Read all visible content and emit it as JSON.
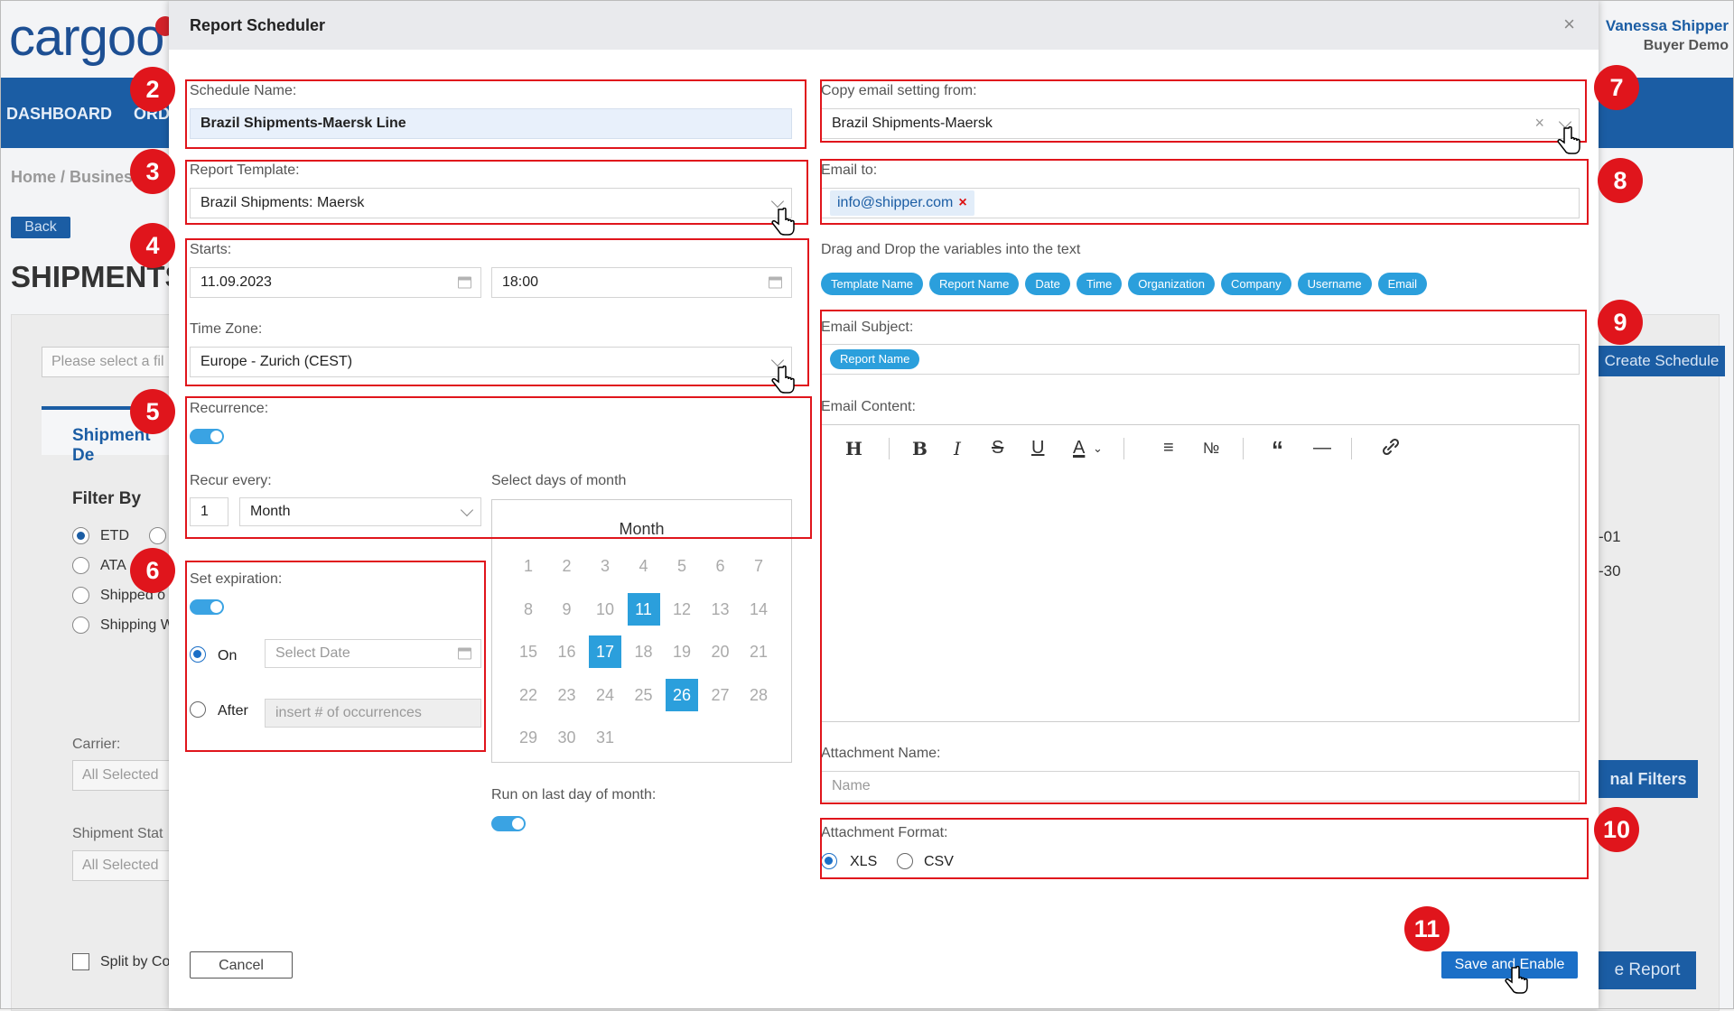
{
  "background": {
    "logo": "cargoo",
    "nav": [
      "DASHBOARD",
      "ORD"
    ],
    "user": {
      "name": "Vanessa Shipper",
      "company": "Buyer Demo"
    },
    "breadcrumb": "Home / Busines",
    "back_label": "Back",
    "page_title": "SHIPMENTS",
    "filter_select_placeholder": "Please select a fil",
    "tab_label": "Shipment De",
    "filter_by": "Filter By",
    "filter_options": [
      "ETD",
      "ATA",
      "Shipped o",
      "Shipping W"
    ],
    "carrier_label": "Carrier:",
    "carrier_value": "All Selected",
    "status_label": "Shipment Stat",
    "status_value": "All Selected",
    "split_label": "Split by Co",
    "create_schedule_label": "Create Schedule",
    "additional_filters_label": "nal Filters",
    "report_label": "e Report",
    "date_1": "-01",
    "date_2": "-30"
  },
  "modal": {
    "title": "Report Scheduler",
    "schedule_name": {
      "label": "Schedule Name:",
      "value": "Brazil Shipments-Maersk Line"
    },
    "report_template": {
      "label": "Report Template:",
      "value": "Brazil Shipments: Maersk"
    },
    "starts": {
      "label": "Starts:",
      "date": "11.09.2023",
      "time": "18:00"
    },
    "timezone": {
      "label": "Time Zone:",
      "value": "Europe - Zurich (CEST)"
    },
    "recurrence": {
      "label": "Recurrence:",
      "enabled": true
    },
    "recur_every": {
      "label": "Recur every:",
      "count": "1",
      "unit": "Month"
    },
    "days_of_month": {
      "label": "Select days of month",
      "title": "Month",
      "weeks": [
        [
          "1",
          "2",
          "3",
          "4",
          "5",
          "6",
          "7"
        ],
        [
          "8",
          "9",
          "10",
          "11",
          "12",
          "13",
          "14"
        ],
        [
          "15",
          "16",
          "17",
          "18",
          "19",
          "20",
          "21"
        ],
        [
          "22",
          "23",
          "24",
          "25",
          "26",
          "27",
          "28"
        ],
        [
          "29",
          "30",
          "31"
        ]
      ],
      "selected": [
        "11",
        "17",
        "26"
      ]
    },
    "expiration": {
      "label": "Set expiration:",
      "enabled": true,
      "on_label": "On",
      "on_placeholder": "Select Date",
      "after_label": "After",
      "after_placeholder": "insert # of occurrences",
      "selected": "On"
    },
    "last_day": {
      "label": "Run on last day of month:",
      "enabled": true
    },
    "copy_email": {
      "label": "Copy email setting from:",
      "value": "Brazil Shipments-Maersk"
    },
    "email_to": {
      "label": "Email to:",
      "recipients": [
        "info@shipper.com"
      ]
    },
    "variables_hint": "Drag and Drop the variables into the text",
    "variables": [
      "Template Name",
      "Report Name",
      "Date",
      "Time",
      "Organization",
      "Company",
      "Username",
      "Email"
    ],
    "email_subject": {
      "label": "Email Subject:",
      "chips": [
        "Report Name"
      ]
    },
    "email_content": {
      "label": "Email Content:"
    },
    "attachment_name": {
      "label": "Attachment Name:",
      "placeholder": "Name"
    },
    "attachment_format": {
      "label": "Attachment Format:",
      "options": [
        "XLS",
        "CSV"
      ],
      "selected": "XLS"
    },
    "cancel_label": "Cancel",
    "save_label": "Save and Enable",
    "close_glyph": "×"
  },
  "annotations": [
    "2",
    "3",
    "4",
    "5",
    "6",
    "7",
    "8",
    "9",
    "10",
    "11"
  ],
  "colors": {
    "accent": "#2b9fdc",
    "primary": "#1b6fc7",
    "annotation": "#e0151c",
    "nav": "#1b5da4"
  }
}
